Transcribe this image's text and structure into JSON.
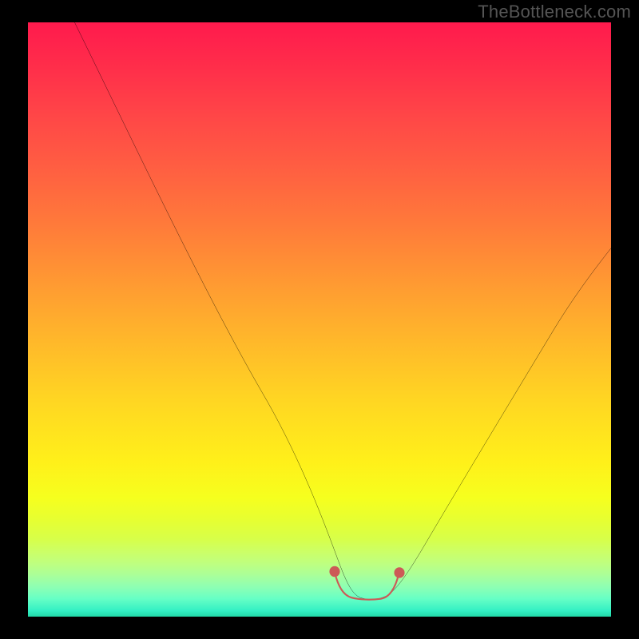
{
  "watermark": "TheBottleneck.com",
  "chart_data": {
    "type": "line",
    "title": "",
    "xlabel": "",
    "ylabel": "",
    "xlim": [
      0,
      100
    ],
    "ylim": [
      0,
      100
    ],
    "grid": false,
    "legend": false,
    "annotations": [],
    "series": [
      {
        "name": "bottleneck-curve",
        "color": "#000000",
        "x": [
          8,
          12,
          16,
          20,
          24,
          28,
          32,
          36,
          40,
          44,
          48,
          50,
          52,
          54,
          56,
          58,
          60,
          62,
          66,
          70,
          74,
          78,
          82,
          86,
          90,
          94,
          98,
          100
        ],
        "y": [
          100,
          93,
          86,
          78,
          70,
          62,
          54,
          46,
          38,
          30,
          22,
          16,
          10,
          5,
          3,
          2,
          2,
          3,
          6,
          11,
          17,
          24,
          31,
          38,
          45,
          52,
          58,
          61
        ]
      },
      {
        "name": "optimal-zone-marker",
        "color": "#cc5a57",
        "x": [
          52.5,
          53,
          54,
          55,
          56,
          57,
          58,
          59,
          60,
          61,
          62,
          63,
          63.5
        ],
        "y": [
          7.5,
          5,
          3.5,
          3,
          2.8,
          2.8,
          2.8,
          2.8,
          3,
          3.2,
          3.8,
          5,
          7.5
        ]
      }
    ],
    "background_gradient_stops": [
      {
        "pos": 0.0,
        "color": "#ff1a4d"
      },
      {
        "pos": 0.5,
        "color": "#ffb31f"
      },
      {
        "pos": 0.8,
        "color": "#f6ff1e"
      },
      {
        "pos": 1.0,
        "color": "#21d8a7"
      }
    ]
  }
}
